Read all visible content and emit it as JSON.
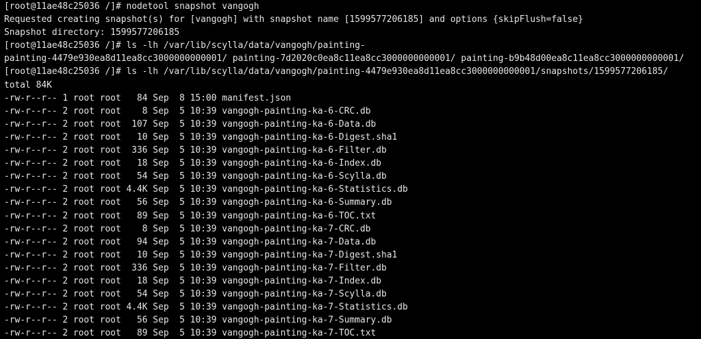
{
  "terminal": {
    "lines": [
      "[root@11ae48c25036 /]# nodetool snapshot vangogh",
      "Requested creating snapshot(s) for [vangogh] with snapshot name [1599577206185] and options {skipFlush=false}",
      "Snapshot directory: 1599577206185",
      "[root@11ae48c25036 /]# ls -lh /var/lib/scylla/data/vangogh/painting-",
      "painting-4479e930ea8d11ea8cc3000000000001/ painting-7d2020c0ea8c11ea8cc3000000000001/ painting-b9b48d00ea8c11ea8cc3000000000001/",
      "[root@11ae48c25036 /]# ls -lh /var/lib/scylla/data/vangogh/painting-4479e930ea8d11ea8cc3000000000001/snapshots/1599577206185/",
      "total 84K",
      "-rw-r--r-- 1 root root   84 Sep  8 15:00 manifest.json",
      "-rw-r--r-- 2 root root    8 Sep  5 10:39 vangogh-painting-ka-6-CRC.db",
      "-rw-r--r-- 2 root root  107 Sep  5 10:39 vangogh-painting-ka-6-Data.db",
      "-rw-r--r-- 2 root root   10 Sep  5 10:39 vangogh-painting-ka-6-Digest.sha1",
      "-rw-r--r-- 2 root root  336 Sep  5 10:39 vangogh-painting-ka-6-Filter.db",
      "-rw-r--r-- 2 root root   18 Sep  5 10:39 vangogh-painting-ka-6-Index.db",
      "-rw-r--r-- 2 root root   54 Sep  5 10:39 vangogh-painting-ka-6-Scylla.db",
      "-rw-r--r-- 2 root root 4.4K Sep  5 10:39 vangogh-painting-ka-6-Statistics.db",
      "-rw-r--r-- 2 root root   56 Sep  5 10:39 vangogh-painting-ka-6-Summary.db",
      "-rw-r--r-- 2 root root   89 Sep  5 10:39 vangogh-painting-ka-6-TOC.txt",
      "-rw-r--r-- 2 root root    8 Sep  5 10:39 vangogh-painting-ka-7-CRC.db",
      "-rw-r--r-- 2 root root   94 Sep  5 10:39 vangogh-painting-ka-7-Data.db",
      "-rw-r--r-- 2 root root   10 Sep  5 10:39 vangogh-painting-ka-7-Digest.sha1",
      "-rw-r--r-- 2 root root  336 Sep  5 10:39 vangogh-painting-ka-7-Filter.db",
      "-rw-r--r-- 2 root root   18 Sep  5 10:39 vangogh-painting-ka-7-Index.db",
      "-rw-r--r-- 2 root root   54 Sep  5 10:39 vangogh-painting-ka-7-Scylla.db",
      "-rw-r--r-- 2 root root 4.4K Sep  5 10:39 vangogh-painting-ka-7-Statistics.db",
      "-rw-r--r-- 2 root root   56 Sep  5 10:39 vangogh-painting-ka-7-Summary.db",
      "-rw-r--r-- 2 root root   89 Sep  5 10:39 vangogh-painting-ka-7-TOC.txt"
    ],
    "colors": {
      "background": "#000000",
      "foreground": "#e6e6e6"
    }
  }
}
